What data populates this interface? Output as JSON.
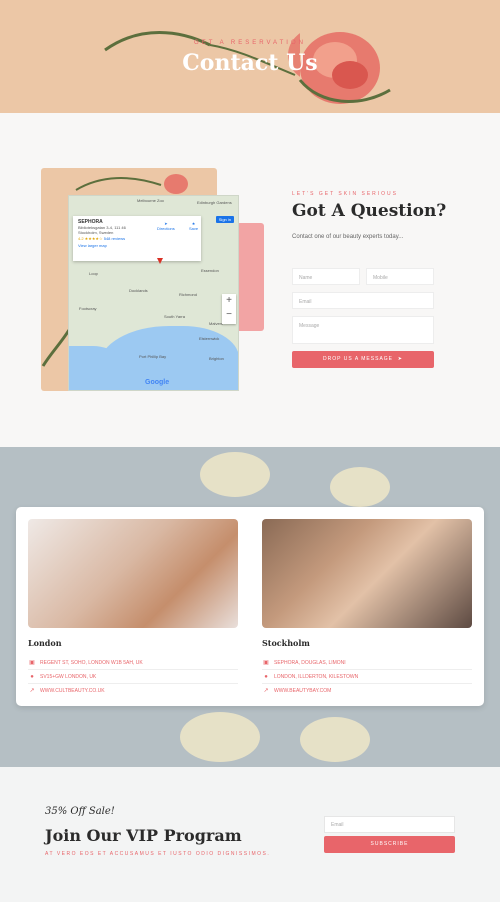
{
  "colors": {
    "accent": "#e8656a",
    "peach": "#ecc7a6",
    "pink": "#f2a4a4"
  },
  "hero": {
    "eyebrow": "GET A RESERVATION",
    "title": "Contact Us"
  },
  "map": {
    "place_name": "SEPHORA",
    "address_line1": "Biblioteksgatan 3-4, 111 46",
    "address_line2": "Stockholm, Sweden",
    "rating": "4.2 ★★★★☆",
    "reviews": "548 reviews",
    "view_larger": "View larger map",
    "directions": "Directions",
    "save": "Save",
    "sign_in": "Sign in",
    "zoom_in": "+",
    "zoom_out": "−",
    "brand": "Google",
    "labels": [
      "Melbourne Zoo",
      "Edinburgh Gardens",
      "Loop",
      "Essendon",
      "Docklands",
      "Richmond",
      "Footscray",
      "South Yarra",
      "Port Phillip Bay",
      "Elsternwick",
      "Malvern",
      "Brighton"
    ]
  },
  "contact": {
    "eyebrow": "LET'S GET SKIN SERIOUS",
    "title": "Got A Question?",
    "subtitle": "Contact one of our beauty experts today...",
    "name_placeholder": "Name",
    "mobile_placeholder": "Mobile",
    "email_placeholder": "Email",
    "message_placeholder": "Message",
    "button_label": "DROP US A MESSAGE"
  },
  "locations": [
    {
      "name": "London",
      "address": "REGENT ST, SOHO, LONDON W1B 5AH, UK",
      "postal": "SV15+GW LONDON, UK",
      "website": "WWW.CULTBEAUTY.CO.UK"
    },
    {
      "name": "Stockholm",
      "address": "SEPHORA, DOUGLAS, LIMONI",
      "postal": "LONDON, ILLDERTON, KILESTOWN",
      "website": "WWW.BEAUTYBAY.COM"
    }
  ],
  "vip": {
    "sale": "35% Off Sale!",
    "title": "Join Our VIP Program",
    "subtitle": "AT VERO EOS ET ACCUSAMUS ET IUSTO ODIO DIGNISSIMOS.",
    "email_placeholder": "Email",
    "button_label": "SUBSCRIBE"
  }
}
